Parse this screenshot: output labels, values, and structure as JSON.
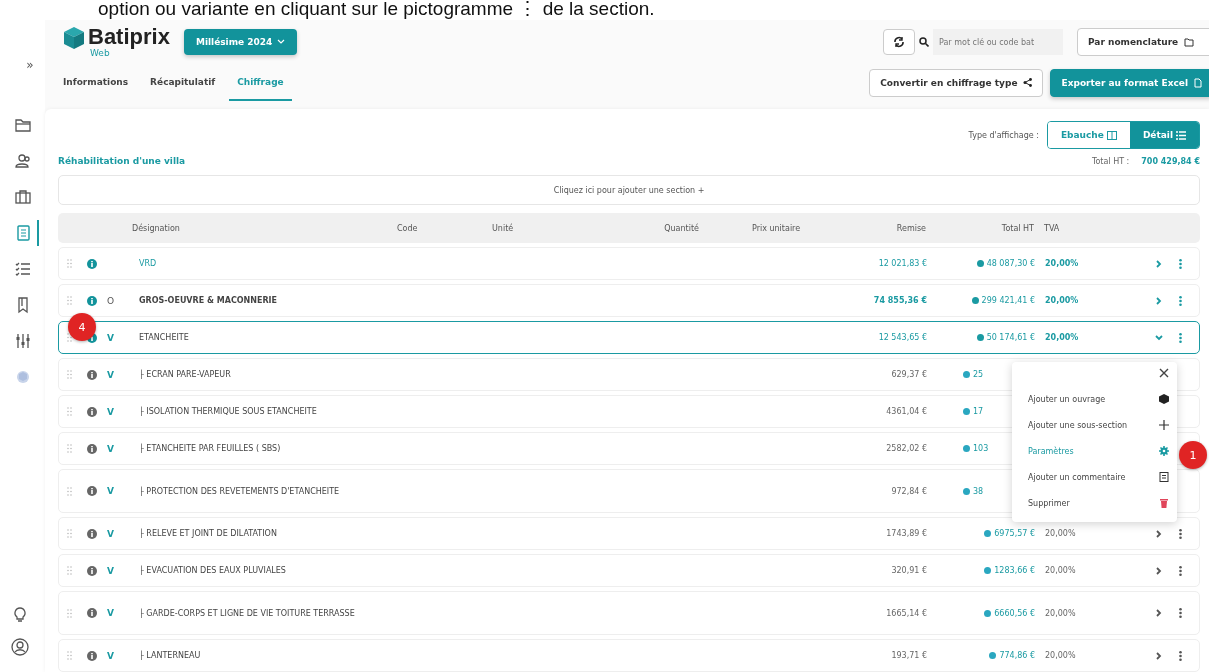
{
  "caption": "option ou variante en cliquant sur le pictogramme ⋮ de la section.",
  "app": {
    "logo": "Batiprix",
    "logo_sub": "Web",
    "edition": "Millésime 2024"
  },
  "header": {
    "search": {
      "placeholder": "Par mot clé ou code bat"
    },
    "filter": "Par nomenclature",
    "convert": "Convertir en chiffrage type",
    "export": "Exporter au format Excel"
  },
  "sidebar": {
    "toggle": "»",
    "items": [
      {
        "selected": false
      },
      {
        "selected": false
      },
      {
        "selected": false
      },
      {
        "selected": true
      },
      {
        "selected": false
      },
      {
        "selected": false
      },
      {
        "selected": false
      },
      {
        "selected": false
      }
    ]
  },
  "tabs": [
    {
      "label": "Informations",
      "selected": false
    },
    {
      "label": "Récapitulatif",
      "selected": false
    },
    {
      "label": "Chiffrage",
      "selected": true
    }
  ],
  "display": {
    "label": "Type d'affichage :",
    "options": [
      {
        "label": "Ebauche",
        "selected": false
      },
      {
        "label": "Détail",
        "selected": true
      }
    ]
  },
  "project": {
    "title": "Réhabilitation d'une villa",
    "total_label": "Total HT :",
    "total": "700 429,84 €"
  },
  "add_section": "Cliquez ici pour ajouter une section +",
  "table": {
    "columns": [
      "Désignation",
      "Code",
      "Unité",
      "Quantité",
      "Prix unitaire",
      "Remise",
      "Total HT",
      "TVA"
    ],
    "rows": [
      {
        "kind": "linked",
        "designation": "VRD",
        "remise": "12 021,83 €",
        "total": "48 087,30 €",
        "tva": "20,00%",
        "expanded": false,
        "selected": false
      },
      {
        "kind": "bold",
        "marker": "O",
        "designation": "GROS-OEUVRE & MACONNERIE",
        "remise": "74 855,36 €",
        "total": "299 421,41 €",
        "tva": "20,00%",
        "expanded": false,
        "selected": false
      },
      {
        "kind": "plain",
        "marker": "V",
        "designation": "ETANCHEITE",
        "remise": "12 543,65 €",
        "total": "50 174,61 €",
        "tva": "20,00%",
        "expanded": true,
        "selected": true,
        "children": [
          {
            "kind": "subsection",
            "marker": "V",
            "branch": "├",
            "designation": "ECRAN PARE-VAPEUR",
            "remise": "629,37 €",
            "total": "25"
          },
          {
            "kind": "subsection",
            "marker": "V",
            "branch": "├",
            "designation": "ISOLATION THERMIQUE SOUS ETANCHEITE",
            "remise": "4361,04 €",
            "total": "17"
          },
          {
            "kind": "subsection",
            "marker": "V",
            "branch": "├",
            "designation": "ETANCHEITE PAR FEUILLES ( SBS)",
            "remise": "2582,02 €",
            "total": "103"
          },
          {
            "kind": "subsection",
            "marker": "V",
            "branch": "├",
            "designation": "PROTECTION DES REVETEMENTS D'ETANCHEITE",
            "remise": "972,84 €",
            "total": "38"
          },
          {
            "kind": "subsection",
            "marker": "V",
            "branch": "├",
            "designation": "RELEVE ET JOINT DE DILATATION",
            "remise": "1743,89 €",
            "total": "6975,57 €",
            "tva": "20,00%",
            "expanded": false
          },
          {
            "kind": "subsection",
            "marker": "V",
            "branch": "├",
            "designation": "EVACUATION DES EAUX PLUVIALES",
            "remise": "320,91 €",
            "total": "1283,66 €",
            "tva": "20,00%",
            "expanded": false
          },
          {
            "kind": "subsection",
            "marker": "V",
            "branch": "├",
            "designation": "GARDE-CORPS ET LIGNE DE VIE TOITURE TERRASSE",
            "remise": "1665,14 €",
            "total": "6660,56 €",
            "tva": "20,00%",
            "expanded": false
          },
          {
            "kind": "subsection",
            "marker": "V",
            "branch": "├",
            "designation": "LANTERNEAU",
            "remise": "193,71 €",
            "total": "774,86 €",
            "tva": "20,00%",
            "expanded": false
          }
        ]
      }
    ]
  },
  "menu": {
    "items": [
      {
        "label": "Ajouter un ouvrage",
        "selected": false
      },
      {
        "label": "Ajouter une sous-section",
        "selected": false
      },
      {
        "label": "Paramètres",
        "selected": true
      },
      {
        "label": "Ajouter un commentaire",
        "selected": false
      },
      {
        "label": "Supprimer",
        "selected": false
      }
    ]
  },
  "callouts": [
    "4",
    "1"
  ]
}
